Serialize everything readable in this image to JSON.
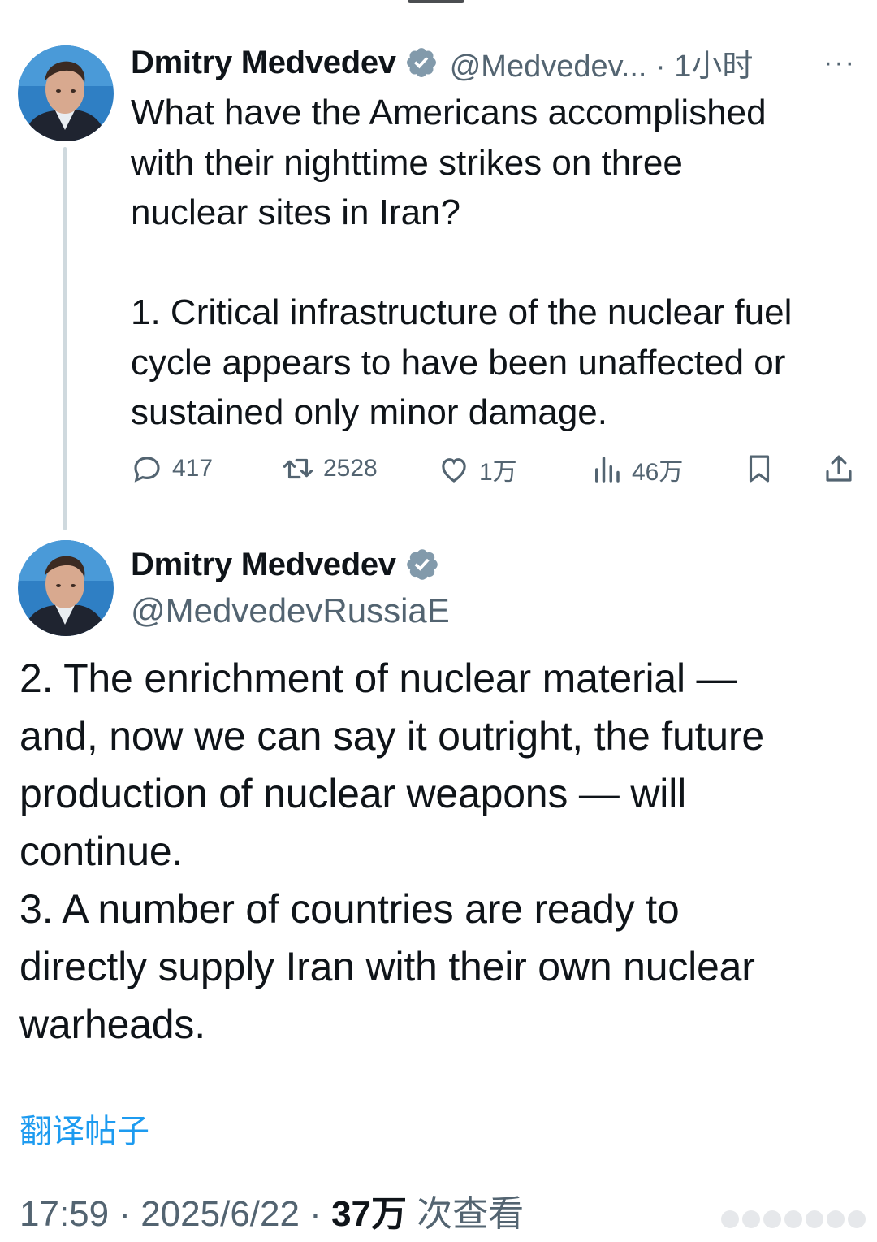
{
  "tweet1": {
    "author_name": "Dmitry Medvedev",
    "handle_time": "@Medvedev... · 1小时",
    "more_label": "···",
    "text": "What have the Americans accomplished\nwith their nighttime strikes on three\nnuclear sites in Iran?\n\n1. Critical infrastructure of the nuclear fuel\ncycle appears to have been unaffected or\nsustained only minor damage.",
    "stats": {
      "replies": "417",
      "reposts": "2528",
      "likes": "1万",
      "views": "46万"
    }
  },
  "tweet2": {
    "author_name": "Dmitry Medvedev",
    "handle": "@MedvedevRussiaE",
    "text": "2. The enrichment of nuclear material —\nand, now we can say it outright, the future\nproduction of nuclear weapons — will\ncontinue.\n3. A number of countries are ready to\ndirectly supply Iran with their own nuclear\nwarheads."
  },
  "translate_label": "翻译帖子",
  "meta": {
    "time_date": "17:59 · 2025/6/22 · ",
    "view_count": "37万",
    "view_suffix": " 次查看"
  },
  "colors": {
    "accent": "#1d9bf0",
    "muted": "#536471",
    "verified_badge": "#829aab",
    "thread_line": "#cfd9de"
  },
  "icons": [
    "reply-icon",
    "repost-icon",
    "like-icon",
    "views-icon",
    "bookmark-icon",
    "share-icon",
    "verified-badge-icon"
  ]
}
